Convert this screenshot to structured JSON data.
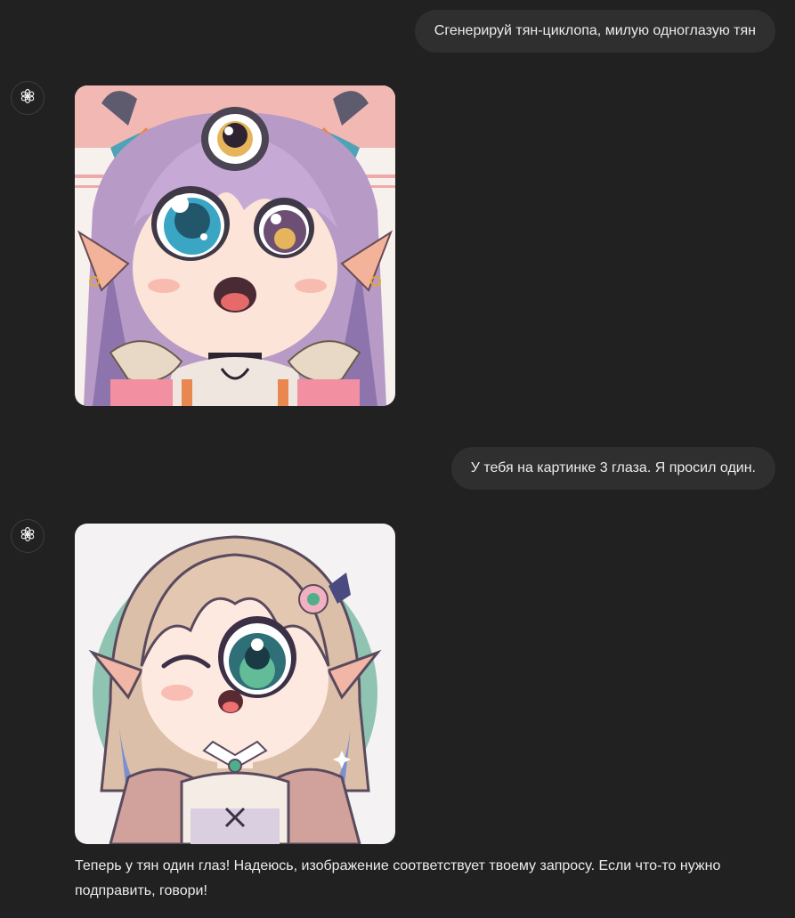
{
  "conversation": {
    "messages": [
      {
        "role": "user",
        "text": "Сгенерируй тян-циклопа, милую одноглазую тян"
      },
      {
        "role": "assistant",
        "image_subject": "anime girl with three eyes, lavender hair, horns"
      },
      {
        "role": "user",
        "text": "У тебя на картинке 3 глаза. Я просил один."
      },
      {
        "role": "assistant",
        "image_subject": "anime girl with one large eye, elf ears, teal background circle",
        "text": "Теперь у тян один глаз! Надеюсь, изображение соответствует твоему запросу. Если что-то нужно подправить, говори!"
      }
    ]
  },
  "icons": {
    "assistant_avatar": "openai-logo-icon"
  },
  "colors": {
    "background": "#212121",
    "user_bubble": "#2f2f2f",
    "text": "#ececec"
  }
}
